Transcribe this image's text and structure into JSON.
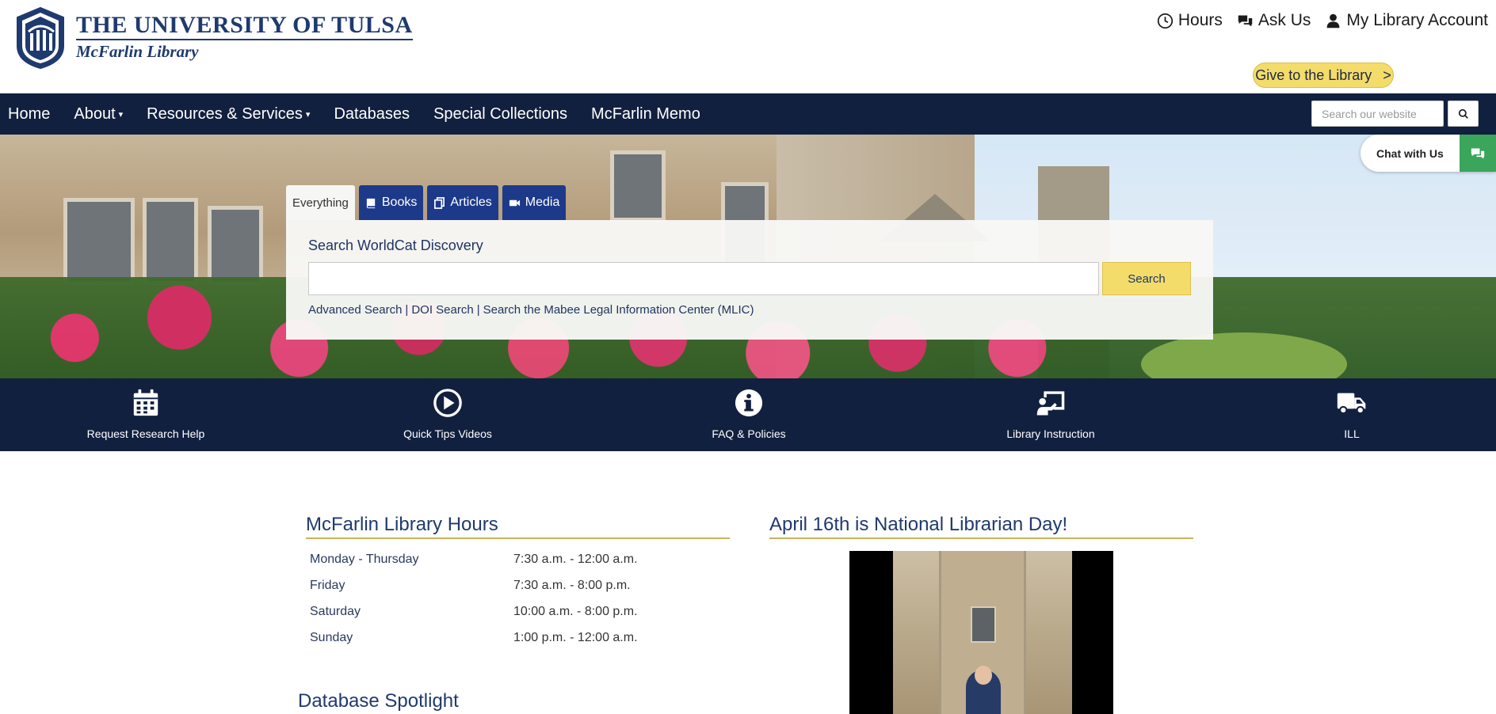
{
  "header": {
    "logo_university": "THE UNIVERSITY OF TULSA",
    "logo_library": "McFarlin Library",
    "util_links": [
      {
        "icon": "clock-icon",
        "label": "Hours"
      },
      {
        "icon": "chat-bubbles-icon",
        "label": "Ask Us"
      },
      {
        "icon": "user-icon",
        "label": "My Library Account"
      }
    ],
    "give_label": "Give to the Library",
    "give_arrow": ">"
  },
  "nav": {
    "items": [
      {
        "label": "Home",
        "dropdown": false
      },
      {
        "label": "About",
        "dropdown": true
      },
      {
        "label": "Resources & Services",
        "dropdown": true
      },
      {
        "label": "Databases",
        "dropdown": false
      },
      {
        "label": "Special Collections",
        "dropdown": false
      },
      {
        "label": "McFarlin Memo",
        "dropdown": false
      }
    ],
    "caret": "▾",
    "search_placeholder": "Search our website"
  },
  "chat": {
    "label": "Chat with Us",
    "color": "#3aa55b"
  },
  "search_panel": {
    "tabs": [
      {
        "label": "Everything",
        "icon": null
      },
      {
        "label": "Books",
        "icon": "book-icon"
      },
      {
        "label": "Articles",
        "icon": "copy-icon"
      },
      {
        "label": "Media",
        "icon": "video-camera-icon"
      }
    ],
    "title": "Search WorldCat Discovery",
    "input_value": "",
    "button_label": "Search",
    "links": [
      "Advanced Search",
      "DOI Search",
      "Search the Mabee Legal Information Center (MLIC)"
    ],
    "separator": "|"
  },
  "quick_links": [
    {
      "icon": "calendar-icon",
      "label": "Request Research Help"
    },
    {
      "icon": "play-circle-icon",
      "label": "Quick Tips Videos"
    },
    {
      "icon": "info-circle-icon",
      "label": "FAQ & Policies"
    },
    {
      "icon": "chalkboard-teacher-icon",
      "label": "Library Instruction"
    },
    {
      "icon": "truck-icon",
      "label": "ILL"
    }
  ],
  "hours": {
    "title": "McFarlin Library Hours",
    "rows": [
      {
        "day": "Monday - Thursday",
        "time": "7:30 a.m. - 12:00 a.m."
      },
      {
        "day": "Friday",
        "time": "7:30 a.m. - 8:00 p.m."
      },
      {
        "day": "Saturday",
        "time": "10:00 a.m. - 8:00 p.m."
      },
      {
        "day": "Sunday",
        "time": "1:00 p.m. - 12:00 a.m."
      }
    ]
  },
  "news": {
    "title": "April 16th is National Librarian Day!"
  },
  "database_spotlight": {
    "title": "Database Spotlight"
  },
  "colors": {
    "navy": "#12203f",
    "gold": "#f4dc6a",
    "tab_blue": "#1d3a8a",
    "rule_gold": "#c8b45a"
  }
}
